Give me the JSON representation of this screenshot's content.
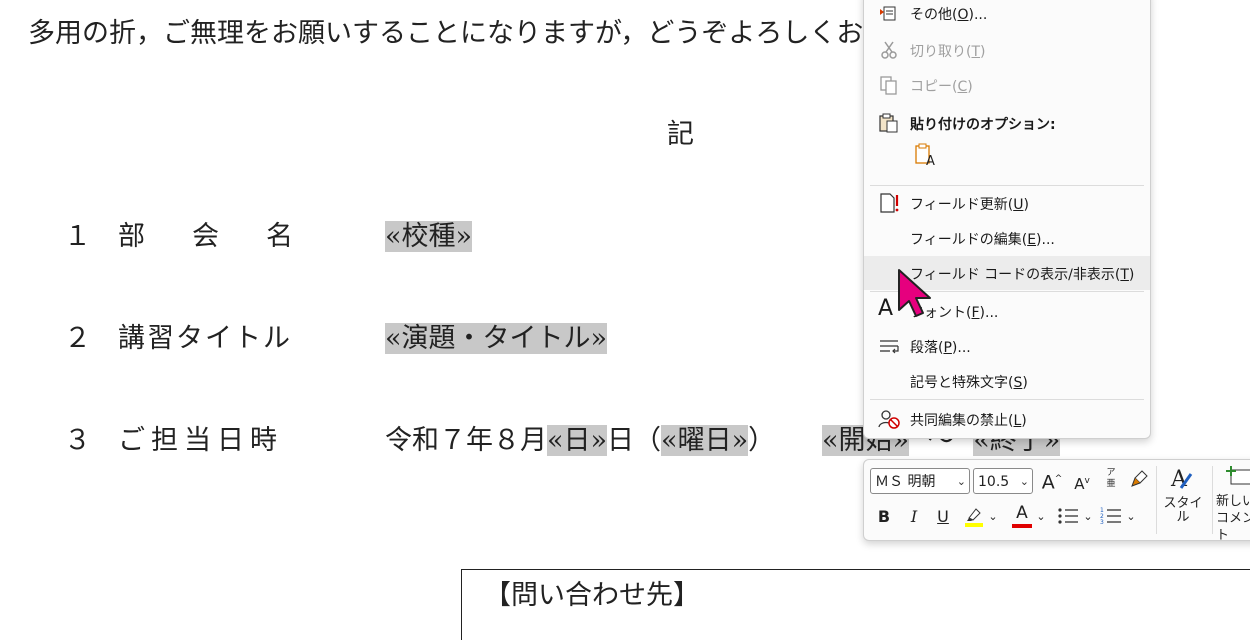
{
  "document": {
    "intro_line": "多用の折，ご無理をお願いすることになりますが，どうぞよろしくお願い申し上げます。",
    "ki": "記",
    "rows": [
      {
        "num": "１",
        "label": "部　会　名",
        "value_field": "«校種»"
      },
      {
        "num": "２",
        "label": "講習タイトル",
        "value_field": "«演題・タイトル»"
      },
      {
        "num": "３",
        "label": "ご担当日時",
        "value_prefix": "令和７年８月",
        "day_field": "«日»",
        "day_suffix": "日（",
        "weekday_field": "«曜日»",
        "close_paren": "）",
        "start_field": "«開始»",
        "tilde": "〜",
        "end_field": "«終了»"
      }
    ],
    "contact_title": "【問い合わせ先】"
  },
  "context_menu": {
    "items": [
      {
        "label": "その他(",
        "key": "O",
        "suffix": ")...",
        "icon": "more-icon",
        "enabled": true
      },
      {
        "label": "切り取り(",
        "key": "T",
        "suffix": ")",
        "icon": "scissors-icon",
        "enabled": false
      },
      {
        "label": "コピー(",
        "key": "C",
        "suffix": ")",
        "icon": "copy-icon",
        "enabled": false
      },
      {
        "label": "貼り付けのオプション:",
        "icon": "paste-icon",
        "enabled": true
      },
      {
        "label": "フィールド更新(",
        "key": "U",
        "suffix": ")",
        "icon": "update-field-icon",
        "enabled": true
      },
      {
        "label": "フィールドの編集(",
        "key": "E",
        "suffix": ")...",
        "enabled": true
      },
      {
        "label": "フィールド コードの表示/非表示(",
        "key": "T",
        "suffix": ")",
        "enabled": true,
        "hovered": true
      },
      {
        "label": "フォント(",
        "key": "F",
        "suffix": ")...",
        "icon": "font-icon",
        "enabled": true
      },
      {
        "label": "段落(",
        "key": "P",
        "suffix": ")...",
        "icon": "paragraph-icon",
        "enabled": true
      },
      {
        "label": "記号と特殊文字(",
        "key": "S",
        "suffix": ")",
        "enabled": true
      },
      {
        "label": "共同編集の禁止(",
        "key": "L",
        "suffix": ")",
        "icon": "block-coauthor-icon",
        "enabled": true
      }
    ]
  },
  "mini_toolbar": {
    "font_name": "ＭＳ 明朝",
    "font_size": "10.5",
    "grow_font": "A",
    "shrink_font": "A",
    "phonetic_top": "ア",
    "phonetic_bottom": "亜",
    "bold": "B",
    "italic": "I",
    "underline": "U",
    "font_color_letter": "A",
    "styles_label": "スタイル",
    "new_comment_label_1": "新しい",
    "new_comment_label_2": "コメント",
    "colors": {
      "highlight": "#ffff00",
      "font_color": "#e00000",
      "accent": "#1f5fbf"
    }
  },
  "cursor": {
    "icon": "pointer-cursor-icon",
    "color": "#e6007e"
  }
}
